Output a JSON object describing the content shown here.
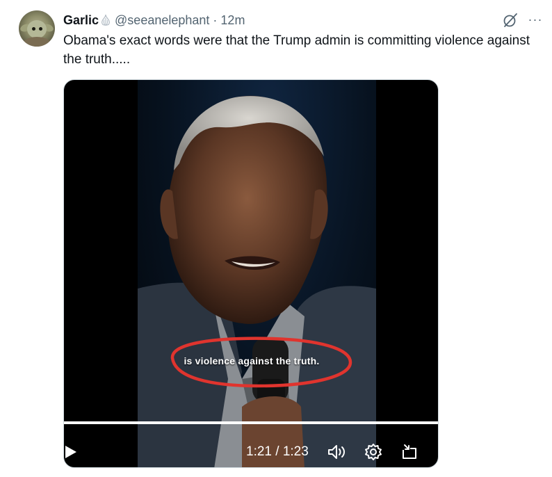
{
  "tweet": {
    "display_name": "Garlic",
    "handle": "@seeanelephant",
    "separator": "·",
    "time": "12m",
    "text": "Obama's exact words were that the Trump admin is committing violence against the truth.....",
    "more_label": "···"
  },
  "media": {
    "subtitle": "is violence against the truth.",
    "time_current": "1:21",
    "time_total": "1:23",
    "time_readout": "1:21 / 1:23",
    "progress": 0.976,
    "annotation_color": "#e0342e"
  },
  "icons": {
    "verified_badge": "garlic-icon",
    "grok": "grok-icon",
    "more": "more-icon",
    "play": "play-icon",
    "volume": "volume-icon",
    "settings": "settings-icon",
    "expand": "expand-icon"
  }
}
